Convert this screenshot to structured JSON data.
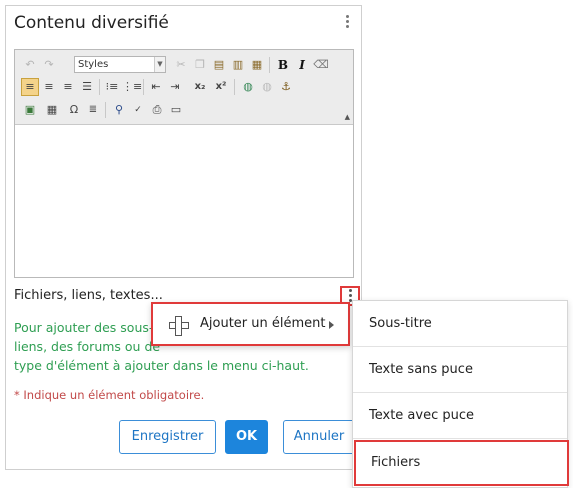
{
  "panel": {
    "title": "Contenu diversifié"
  },
  "editor": {
    "styles_label": "Styles",
    "toolbar_row1": [
      "undo-icon",
      "redo-icon",
      "styles-select",
      "cut-icon",
      "copy-icon",
      "paste-icon",
      "paste-text-icon",
      "paste-word-icon",
      "bold-icon",
      "italic-icon",
      "eraser-icon"
    ],
    "toolbar_row2": [
      "align-left-icon",
      "align-center-icon",
      "align-right-icon",
      "justify-icon",
      "bullet-list-icon",
      "numbered-list-icon",
      "outdent-icon",
      "indent-icon",
      "subscript-icon",
      "superscript-icon",
      "link-icon",
      "unlink-icon",
      "anchor-icon"
    ],
    "toolbar_row3": [
      "image-icon",
      "table-icon",
      "omega-icon",
      "find-icon",
      "spellcheck-icon",
      "print-icon",
      "source-icon"
    ],
    "bold_label": "B",
    "italic_label": "I",
    "omega_label": "Ω"
  },
  "section": {
    "label": "Fichiers, liens, textes..."
  },
  "help": {
    "line1": "Pour ajouter des sous-",
    "line2": "liens, des forums ou de",
    "line3": "type d'élément à ajouter dans le menu ci-haut."
  },
  "required_note": "* Indique un élément obligatoire.",
  "buttons": {
    "save": "Enregistrer",
    "ok": "OK",
    "cancel": "Annuler"
  },
  "context_menu": {
    "add_element": "Ajouter un élément"
  },
  "submenu": {
    "items": [
      "Sous-titre",
      "Texte sans puce",
      "Texte avec puce",
      "Fichiers"
    ]
  },
  "colors": {
    "highlight_border": "#e03a3a",
    "help_text": "#2e9e52",
    "required_text": "#c24a4a",
    "primary_button": "#1d85dc"
  }
}
